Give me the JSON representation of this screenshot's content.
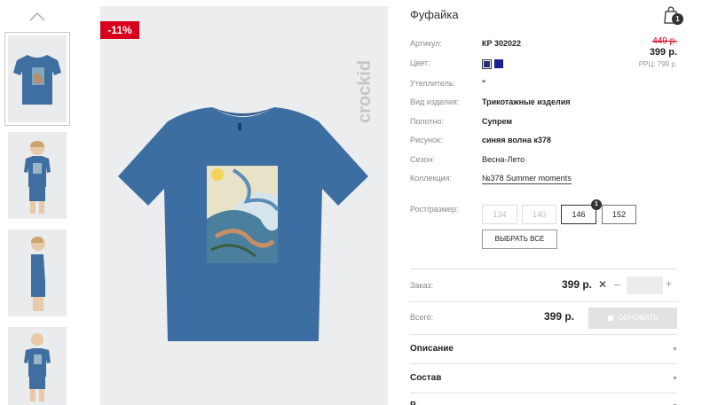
{
  "product": {
    "title": "Фуфайка",
    "sale_badge": "-11%",
    "brand": "crockid",
    "old_price": "449 р.",
    "price": "399 р.",
    "rrp": "РРЦ: 799 р."
  },
  "cart": {
    "count": "1",
    "icon": "bag-icon"
  },
  "properties": [
    {
      "label": "Артикул:",
      "value": "КР 302022"
    },
    {
      "label": "Цвет:",
      "value": ""
    },
    {
      "label": "Утеплитель:",
      "value": "\""
    },
    {
      "label": "Вид изделия:",
      "value": "Трикотажные изделия"
    },
    {
      "label": "Полотно:",
      "value": "Супрем"
    },
    {
      "label": "Рисунок:",
      "value": "синяя волна к378"
    },
    {
      "label": "Сезон:",
      "value": "Весна-Лето"
    },
    {
      "label": "Коллекция:",
      "value": "№378 Summer moments"
    }
  ],
  "colors": [
    "#23307a",
    "#1b1f8f"
  ],
  "sizes": {
    "label": "Рост/размер:",
    "options": [
      "134",
      "140",
      "146",
      "152"
    ],
    "selected_qty": "1",
    "select_all": "ВЫБРАТЬ ВСЕ"
  },
  "order": {
    "label": "Заказ:",
    "price": "399 р.",
    "remove": "✕",
    "minus": "–",
    "plus": "+"
  },
  "total": {
    "label": "Всего:",
    "price": "399 р.",
    "update": "ОБНОВИТЬ"
  },
  "accordion": [
    {
      "label": "Описание",
      "arrow": "▼"
    },
    {
      "label": "Состав",
      "arrow": "▼"
    },
    {
      "label": "Р",
      "arrow": "▼"
    }
  ],
  "thumbnail_up": "chevron-up-icon"
}
